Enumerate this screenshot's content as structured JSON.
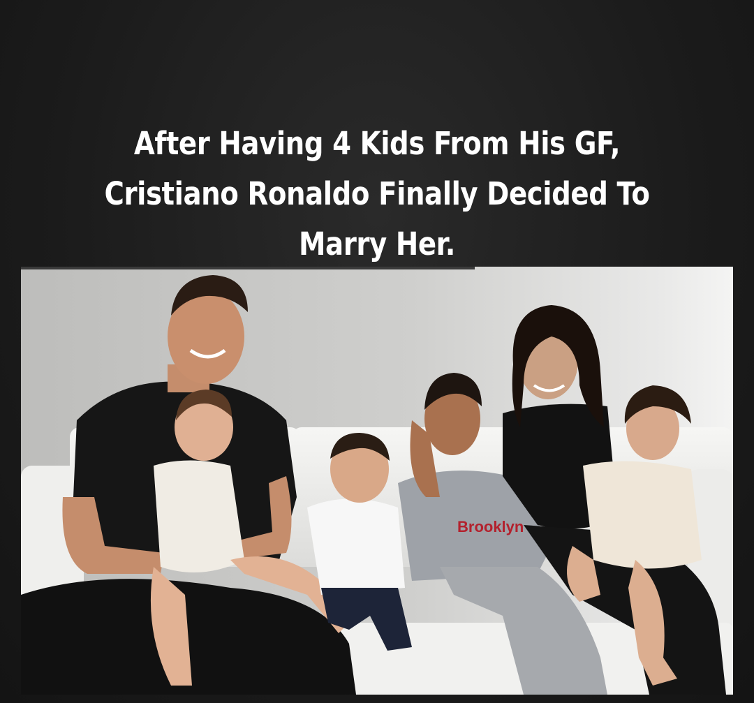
{
  "post": {
    "headline": "After Having 4 Kids From His GF, Cristiano Ronaldo Finally Decided To Marry Her."
  },
  "photo": {
    "subject": "family-portrait-on-white-sofa",
    "shirt_text": "Brooklyn"
  },
  "colors": {
    "background": "#1c1c1c",
    "headline_text": "#ffffff",
    "wall": "#c9c9c7",
    "sofa": "#f3f3f1"
  }
}
